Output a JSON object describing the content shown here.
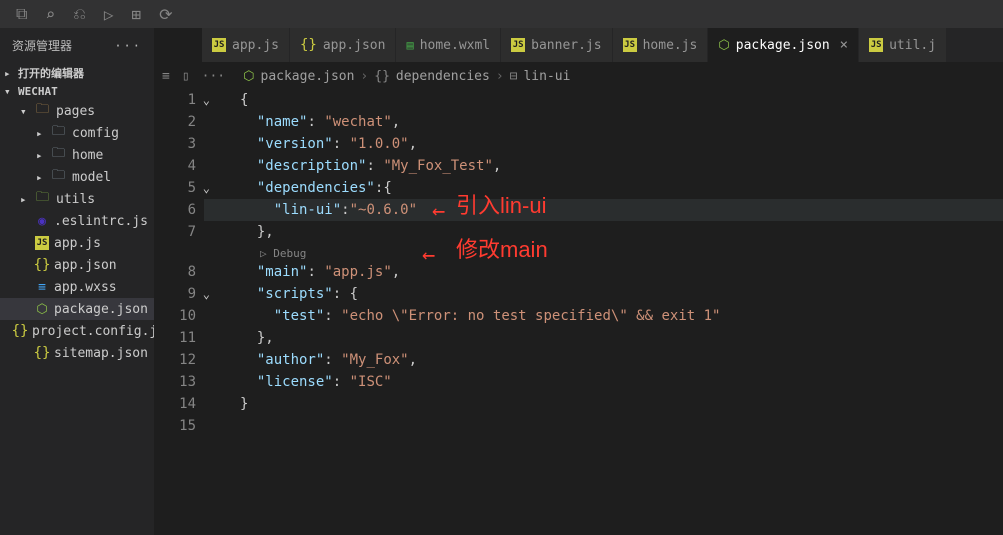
{
  "titlebar": {
    "label": ""
  },
  "tabs": [
    {
      "icon": "js",
      "label": "app.js"
    },
    {
      "icon": "json",
      "label": "app.json"
    },
    {
      "icon": "wxml",
      "label": "home.wxml"
    },
    {
      "icon": "js",
      "label": "banner.js"
    },
    {
      "icon": "js",
      "label": "home.js"
    },
    {
      "icon": "pkg",
      "label": "package.json",
      "active": true
    },
    {
      "icon": "js",
      "label": "util.j"
    }
  ],
  "sidebar": {
    "title": "资源管理器",
    "sections": [
      {
        "label": "打开的编辑器",
        "expanded": false
      },
      {
        "label": "WECHAT",
        "expanded": true
      }
    ],
    "tree": {
      "pages": {
        "label": "pages",
        "children": [
          "comfig",
          "home",
          "model"
        ]
      },
      "utils": {
        "label": "utils"
      },
      "files": [
        {
          "icon": "eslint",
          "label": ".eslintrc.js"
        },
        {
          "icon": "js",
          "label": "app.js"
        },
        {
          "icon": "json",
          "label": "app.json"
        },
        {
          "icon": "wxss",
          "label": "app.wxss"
        },
        {
          "icon": "pkg",
          "label": "package.json",
          "selected": true
        },
        {
          "icon": "json",
          "label": "project.config.json"
        },
        {
          "icon": "json",
          "label": "sitemap.json"
        }
      ]
    }
  },
  "breadcrumb": {
    "items": [
      "package.json",
      "dependencies",
      "lin-ui"
    ]
  },
  "code": {
    "debug_lens": "▷ Debug",
    "lines": [
      {
        "n": 1,
        "fold": "v",
        "raw": "{"
      },
      {
        "n": 2,
        "raw": "  \"name\": \"wechat\","
      },
      {
        "n": 3,
        "raw": "  \"version\": \"1.0.0\","
      },
      {
        "n": 4,
        "raw": "  \"description\": \"My_Fox_Test\","
      },
      {
        "n": 5,
        "fold": "v",
        "raw": "  \"dependencies\":{"
      },
      {
        "n": 6,
        "hl": true,
        "raw": "    \"lin-ui\":\"~0.6.0\""
      },
      {
        "n": 7,
        "raw": "  },"
      },
      {
        "n": 8,
        "raw": "  \"main\": \"app.js\","
      },
      {
        "n": 9,
        "fold": "v",
        "raw": "  \"scripts\": {"
      },
      {
        "n": 10,
        "raw": "    \"test\": \"echo \\\"Error: no test specified\\\" && exit 1\""
      },
      {
        "n": 11,
        "raw": "  },"
      },
      {
        "n": 12,
        "raw": "  \"author\": \"My_Fox\","
      },
      {
        "n": 13,
        "raw": "  \"license\": \"ISC\""
      },
      {
        "n": 14,
        "raw": "}"
      },
      {
        "n": 15,
        "raw": ""
      }
    ]
  },
  "annotations": {
    "a1": "引入lin-ui",
    "a2": "修改main"
  }
}
